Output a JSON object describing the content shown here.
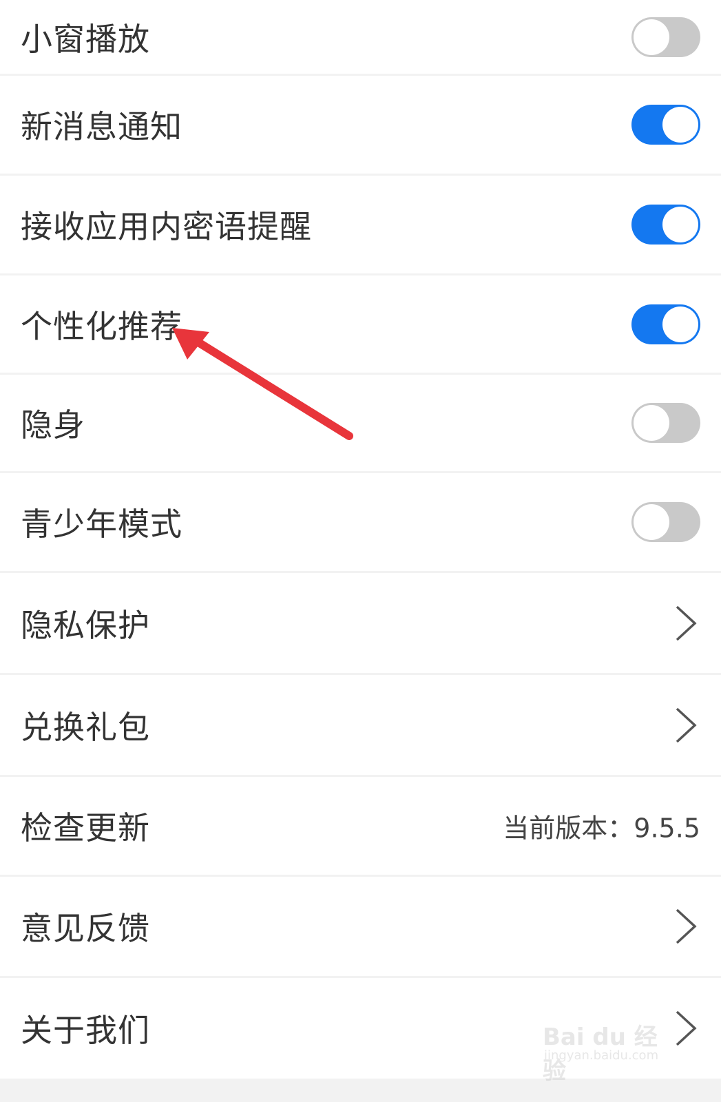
{
  "settings": {
    "items": [
      {
        "label": "小窗播放",
        "control": "toggle",
        "state": "off"
      },
      {
        "label": "新消息通知",
        "control": "toggle",
        "state": "on"
      },
      {
        "label": "接收应用内密语提醒",
        "control": "toggle",
        "state": "on"
      },
      {
        "label": "个性化推荐",
        "control": "toggle",
        "state": "on"
      },
      {
        "label": "隐身",
        "control": "toggle",
        "state": "off"
      },
      {
        "label": "青少年模式",
        "control": "toggle",
        "state": "off"
      },
      {
        "label": "隐私保护",
        "control": "chevron"
      },
      {
        "label": "兑换礼包",
        "control": "chevron"
      },
      {
        "label": "检查更新",
        "control": "value",
        "value": "当前版本：9.5.5"
      },
      {
        "label": "意见反馈",
        "control": "chevron"
      },
      {
        "label": "关于我们",
        "control": "chevron"
      }
    ]
  },
  "colors": {
    "toggle_on": "#1478f0",
    "toggle_off": "#c9c9c9",
    "annotation_arrow": "#e8353b"
  },
  "watermark": {
    "main": "Bai du 经验",
    "sub": "jingyan.baidu.com"
  }
}
